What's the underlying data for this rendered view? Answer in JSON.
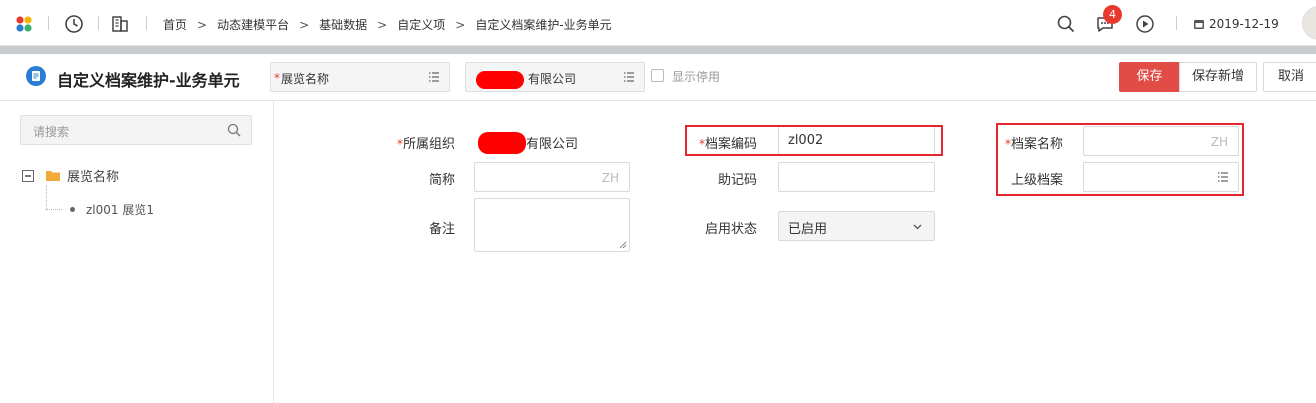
{
  "topbar": {
    "breadcrumbs": [
      "首页",
      "动态建模平台",
      "基础数据",
      "自定义项",
      "自定义档案维护-业务单元"
    ],
    "notification_count": "4",
    "date": "2019-12-19"
  },
  "header": {
    "title": "自定义档案维护-业务单元",
    "archive_select": "展览名称",
    "org_select": "有限公司",
    "show_disabled_label": "显示停用",
    "buttons": {
      "save": "保存",
      "save_new": "保存新增",
      "cancel": "取消"
    }
  },
  "sidebar": {
    "search_placeholder": "请搜索",
    "tree_root": "展览名称",
    "tree_children": [
      "zl001 展览1"
    ]
  },
  "form": {
    "org_label": "所属组织",
    "org_value": "有限公司",
    "short_label": "简称",
    "short_suffix": "ZH",
    "remark_label": "备注",
    "code_label": "档案编码",
    "code_value": "zl002",
    "mnemonic_label": "助记码",
    "status_label": "启用状态",
    "status_value": "已启用",
    "name_label": "档案名称",
    "name_suffix": "ZH",
    "parent_label": "上级档案"
  },
  "colors": {
    "primary_button": "#e14c46",
    "badge": "#e8392f",
    "highlight_box": "#e5262d",
    "title_icon": "#2b7cd3"
  }
}
